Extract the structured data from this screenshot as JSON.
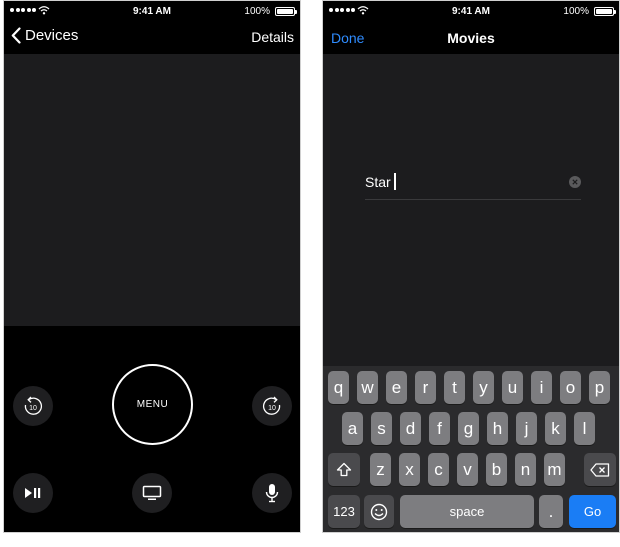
{
  "status_bar": {
    "time": "9:41 AM",
    "battery": "100%"
  },
  "left_screen": {
    "nav": {
      "back_label": "Devices",
      "right_label": "Details"
    },
    "controls": {
      "menu_label": "MENU",
      "skip_back_label": "10",
      "skip_forward_label": "10"
    },
    "icons": [
      "chevron-left-icon",
      "skip-back-10-icon",
      "skip-forward-10-icon",
      "play-pause-icon",
      "tv-icon",
      "microphone-icon"
    ]
  },
  "right_screen": {
    "nav": {
      "done_label": "Done",
      "title": "Movies"
    },
    "search": {
      "value": "Star"
    },
    "keyboard": {
      "row1": [
        "q",
        "w",
        "e",
        "r",
        "t",
        "y",
        "u",
        "i",
        "o",
        "p"
      ],
      "row2": [
        "a",
        "s",
        "d",
        "f",
        "g",
        "h",
        "j",
        "k",
        "l"
      ],
      "row3": [
        "z",
        "x",
        "c",
        "v",
        "b",
        "n",
        "m"
      ],
      "numbers_label": "123",
      "space_label": "space",
      "period_label": ".",
      "go_label": "Go"
    }
  },
  "colors": {
    "accent": "#2f8cff",
    "go_key": "#1a7df5",
    "screen_bg": "#1c1c1e"
  }
}
